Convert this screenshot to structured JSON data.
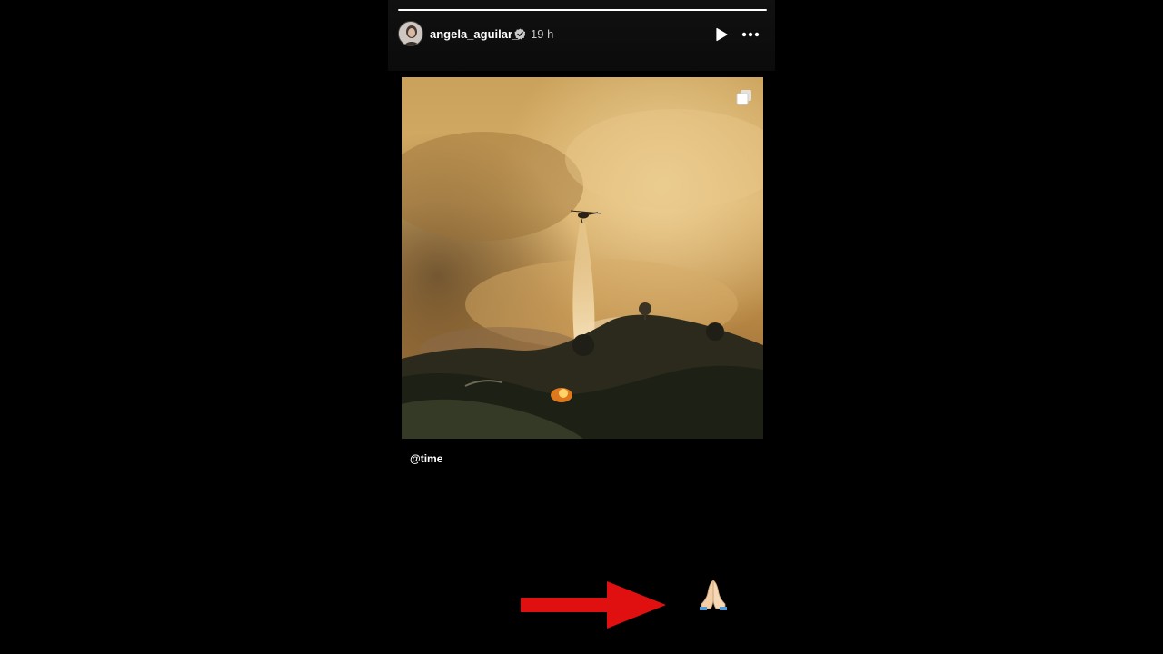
{
  "story": {
    "username": "angela_aguilar_",
    "timestamp": "19 h",
    "progress": 1.0,
    "icons": {
      "verified": "verified-badge-icon",
      "play": "play-icon",
      "more": "more-options-icon",
      "carousel": "carousel-icon"
    }
  },
  "post": {
    "mention": "@time",
    "image_alt": "Helicopter dropping water over a wildfire on a smoky hillside"
  },
  "overlay": {
    "arrow_icon": "red-arrow-icon",
    "emoji_icon": "folded-hands-emoji",
    "arrow_color": "#e11010"
  }
}
